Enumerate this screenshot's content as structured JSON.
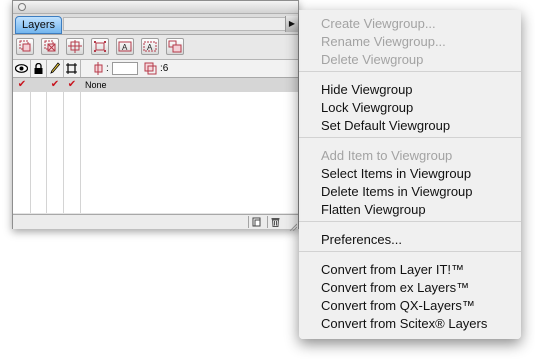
{
  "palette": {
    "tab_label": "Layers",
    "flyout_glyph": "▶",
    "toolbar_icons": [
      "new-layer-icon",
      "delete-layer-icon",
      "merge-layers-icon",
      "duplicate-layer-icon",
      "text-layer-icon",
      "text-outline-icon",
      "layer-options-icon"
    ],
    "columns": {
      "visibility_icon": "eye-icon",
      "lock_icon": "lock-icon",
      "edit_icon": "pencil-icon",
      "frame_icon": "frame-icon",
      "z_label": ":",
      "opacity_value": ":6"
    },
    "layers": [
      {
        "name": "None",
        "visible": true,
        "editable": true,
        "frame": true
      }
    ],
    "footer": {
      "new_icon": "new-page-icon",
      "trash_icon": "trash-icon"
    }
  },
  "menu": {
    "items": [
      {
        "label": "Create Viewgroup...",
        "enabled": false
      },
      {
        "label": "Rename Viewgroup...",
        "enabled": false
      },
      {
        "label": "Delete Viewgroup",
        "enabled": false
      },
      {
        "separator": true
      },
      {
        "label": "Hide Viewgroup",
        "enabled": true
      },
      {
        "label": "Lock Viewgroup",
        "enabled": true
      },
      {
        "label": "Set Default Viewgroup",
        "enabled": true
      },
      {
        "separator": true
      },
      {
        "label": "Add Item to Viewgroup",
        "enabled": false
      },
      {
        "label": "Select Items in Viewgroup",
        "enabled": true
      },
      {
        "label": "Delete Items in Viewgroup",
        "enabled": true
      },
      {
        "label": "Flatten Viewgroup",
        "enabled": true
      },
      {
        "separator": true
      },
      {
        "label": "Preferences...",
        "enabled": true
      },
      {
        "separator": true
      },
      {
        "label": "Convert from Layer IT!™",
        "enabled": true
      },
      {
        "label": "Convert from ex Layers™",
        "enabled": true
      },
      {
        "label": "Convert from QX-Layers™",
        "enabled": true
      },
      {
        "label": "Convert from Scitex® Layers",
        "enabled": true
      }
    ]
  },
  "colors": {
    "tab_blue": "#74b6ef",
    "check_red": "#c8141e",
    "disabled_text": "#a3a3a3"
  }
}
